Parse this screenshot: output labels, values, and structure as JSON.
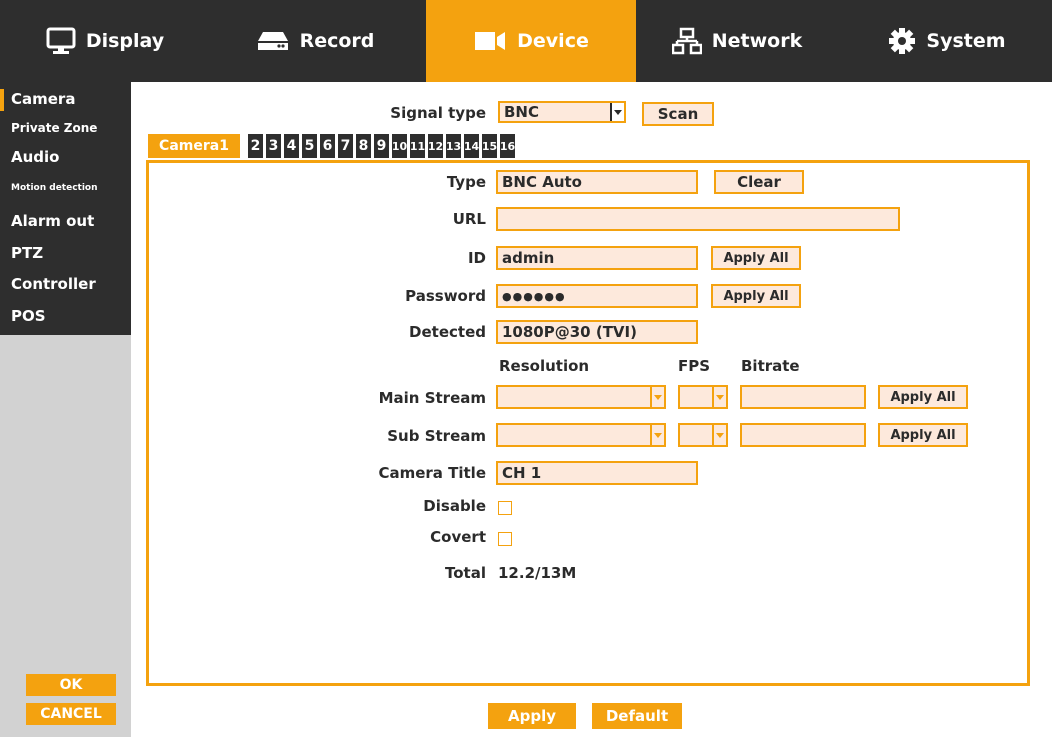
{
  "nav": {
    "tabs": [
      {
        "label": "Display",
        "icon": "monitor-icon"
      },
      {
        "label": "Record",
        "icon": "hdd-icon"
      },
      {
        "label": "Device",
        "icon": "camera-icon",
        "active": true
      },
      {
        "label": "Network",
        "icon": "network-icon"
      },
      {
        "label": "System",
        "icon": "gear-icon"
      }
    ]
  },
  "sidebar": {
    "items": [
      {
        "label": "Camera",
        "active": true
      },
      {
        "label": "Private Zone"
      },
      {
        "label": "Audio"
      },
      {
        "label": "Motion detection"
      },
      {
        "label": "Alarm out"
      },
      {
        "label": "PTZ"
      },
      {
        "label": "Controller"
      },
      {
        "label": "POS"
      }
    ],
    "ok_label": "OK",
    "cancel_label": "CANCEL"
  },
  "signal": {
    "label": "Signal type",
    "value": "BNC",
    "scan_label": "Scan"
  },
  "camera_tabs": [
    "Camera1",
    "2",
    "3",
    "4",
    "5",
    "6",
    "7",
    "8",
    "9",
    "10",
    "11",
    "12",
    "13",
    "14",
    "15",
    "16"
  ],
  "form": {
    "type_label": "Type",
    "type_value": "BNC Auto",
    "clear_label": "Clear",
    "url_label": "URL",
    "url_value": "",
    "id_label": "ID",
    "id_value": "admin",
    "id_apply_all": "Apply All",
    "password_label": "Password",
    "password_value": "●●●●●●",
    "password_apply_all": "Apply All",
    "detected_label": "Detected",
    "detected_value": "1080P@30 (TVI)",
    "col_resolution": "Resolution",
    "col_fps": "FPS",
    "col_bitrate": "Bitrate",
    "main_stream_label": "Main Stream",
    "main_apply_all": "Apply All",
    "sub_stream_label": "Sub Stream",
    "sub_apply_all": "Apply All",
    "camera_title_label": "Camera Title",
    "camera_title_value": "CH 1",
    "disable_label": "Disable",
    "covert_label": "Covert",
    "total_label": "Total",
    "total_value": "12.2/13M"
  },
  "footer": {
    "apply_label": "Apply",
    "default_label": "Default"
  },
  "colors": {
    "accent": "#f4a20f",
    "dark": "#2e2e2e",
    "field_bg": "#fde9dc",
    "sidebar_bg": "#d2d2d2"
  }
}
